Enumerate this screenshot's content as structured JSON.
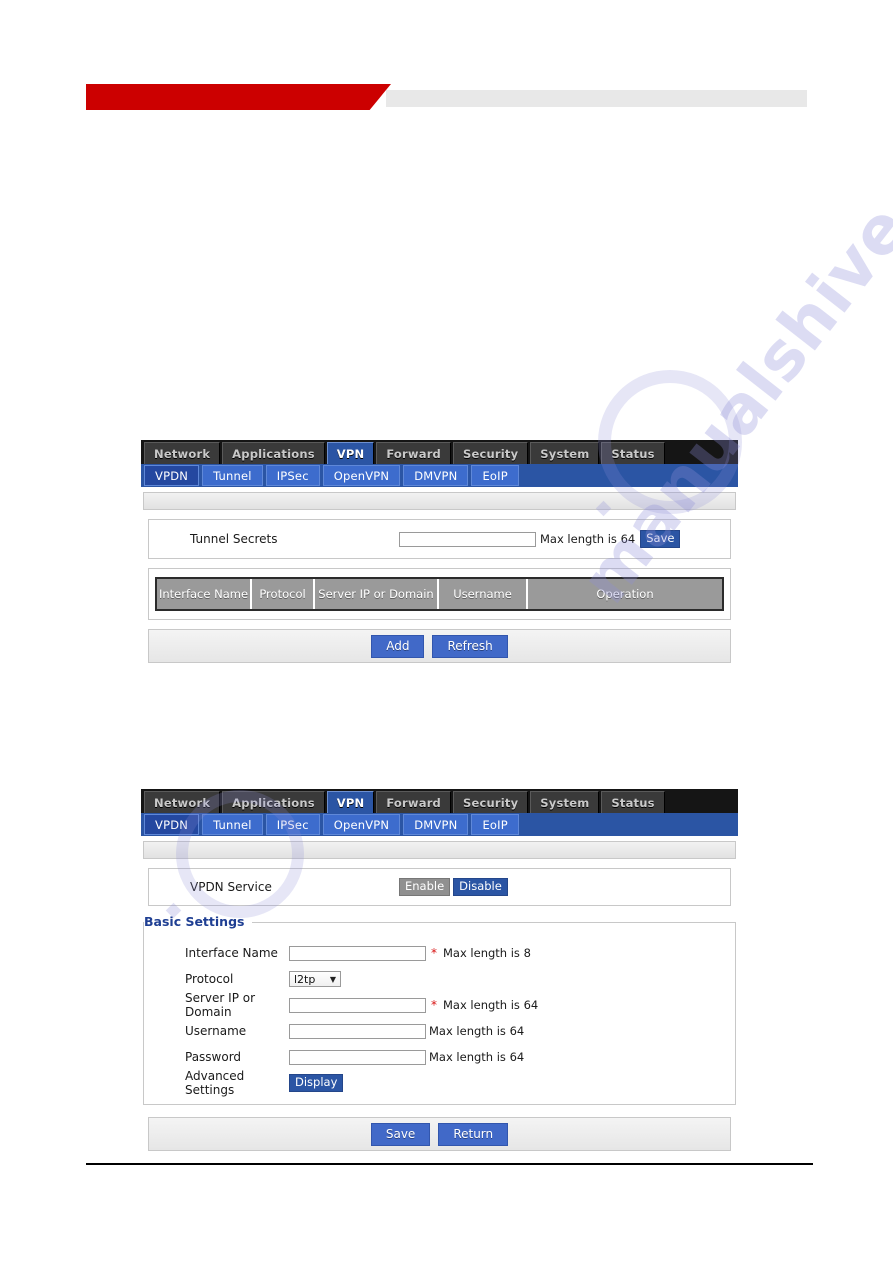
{
  "watermark": {
    "text": "manualshive.com"
  },
  "nav": {
    "top_tabs": [
      {
        "label": "Network",
        "active": false
      },
      {
        "label": "Applications",
        "active": false
      },
      {
        "label": "VPN",
        "active": true
      },
      {
        "label": "Forward",
        "active": false
      },
      {
        "label": "Security",
        "active": false
      },
      {
        "label": "System",
        "active": false
      },
      {
        "label": "Status",
        "active": false
      }
    ],
    "sub_tabs": [
      {
        "label": "VPDN",
        "active": true
      },
      {
        "label": "Tunnel",
        "active": false
      },
      {
        "label": "IPSec",
        "active": false
      },
      {
        "label": "OpenVPN",
        "active": false
      },
      {
        "label": "DMVPN",
        "active": false
      },
      {
        "label": "EoIP",
        "active": false
      }
    ]
  },
  "screen1": {
    "tunnel_secrets": {
      "label": "Tunnel Secrets",
      "value": "",
      "hint": "Max length is 64",
      "save_label": "Save"
    },
    "table": {
      "headers": [
        "Interface Name",
        "Protocol",
        "Server IP or Domain",
        "Username",
        "Operation"
      ],
      "rows": []
    },
    "actions": {
      "add_label": "Add",
      "refresh_label": "Refresh"
    }
  },
  "screen2": {
    "service": {
      "label": "VPDN Service",
      "enable_label": "Enable",
      "disable_label": "Disable",
      "selected": "Disable"
    },
    "basic_settings": {
      "legend": "Basic Settings",
      "fields": [
        {
          "label": "Interface Name",
          "type": "text",
          "value": "",
          "required": true,
          "hint": "Max length is 8"
        },
        {
          "label": "Protocol",
          "type": "select",
          "value": "l2tp",
          "required": false,
          "hint": ""
        },
        {
          "label": "Server IP or Domain",
          "type": "text",
          "value": "",
          "required": true,
          "hint": "Max length is 64"
        },
        {
          "label": "Username",
          "type": "text",
          "value": "",
          "required": false,
          "hint": "Max length is 64"
        },
        {
          "label": "Password",
          "type": "text",
          "value": "",
          "required": false,
          "hint": "Max length is 64"
        },
        {
          "label": "Advanced Settings",
          "type": "button",
          "value": "Display",
          "required": false,
          "hint": ""
        }
      ]
    },
    "actions": {
      "save_label": "Save",
      "return_label": "Return"
    }
  },
  "colors": {
    "brand_red": "#cc0000",
    "nav_blue": "#2b55a4",
    "button_blue": "#4169c8",
    "required_red": "#d81212",
    "header_gray": "#9a9a9a"
  }
}
